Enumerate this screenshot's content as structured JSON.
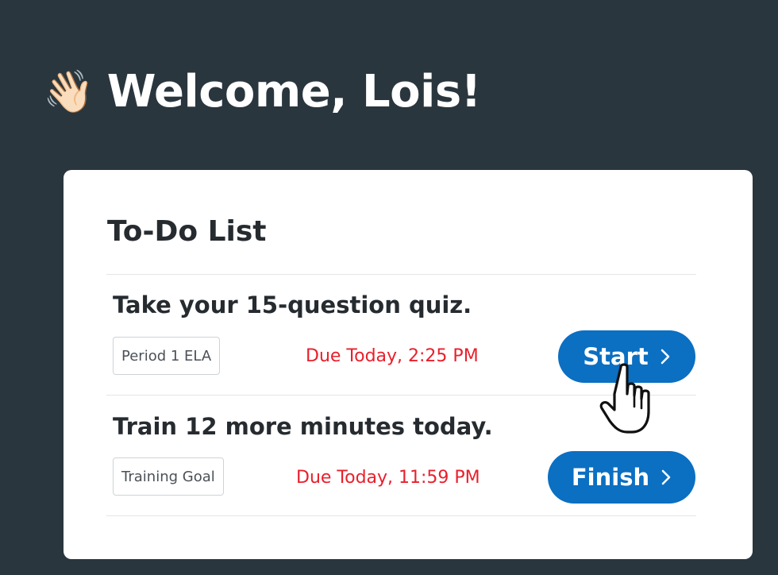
{
  "welcome": {
    "emoji": "👋🏻",
    "heading": "Welcome, Lois!"
  },
  "todo": {
    "title": "To-Do List",
    "tasks": [
      {
        "title": "Take your 15-question quiz.",
        "tag": "Period 1 ELA",
        "due": "Due Today, 2:25 PM",
        "button": "Start"
      },
      {
        "title": "Train 12 more minutes today.",
        "tag": "Training Goal",
        "due": "Due Today, 11:59 PM",
        "button": "Finish"
      }
    ]
  },
  "colors": {
    "background": "#2a363e",
    "card": "#ffffff",
    "accent": "#0b6fc2",
    "due": "#e8202c"
  },
  "icons": {
    "wave": "waving-hand-icon",
    "chevron": "chevron-right-icon",
    "cursor": "pointer-hand-cursor-icon"
  }
}
